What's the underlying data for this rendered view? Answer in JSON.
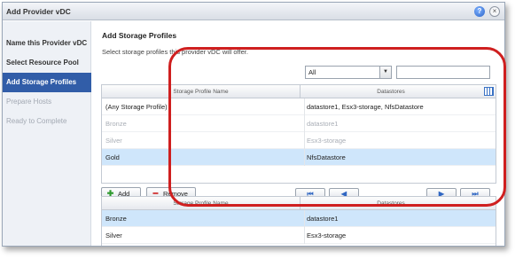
{
  "window": {
    "title": "Add Provider vDC"
  },
  "sidebar": {
    "items": [
      {
        "label": "Name this Provider vDC"
      },
      {
        "label": "Select Resource Pool"
      },
      {
        "label": "Add Storage Profiles"
      },
      {
        "label": "Prepare Hosts"
      },
      {
        "label": "Ready to Complete"
      }
    ]
  },
  "main": {
    "heading": "Add Storage Profiles",
    "subtitle": "Select storage profiles this provider vDC will offer.",
    "filter": {
      "selected": "All"
    },
    "available_table": {
      "columns": [
        "Storage Profile Name",
        "Datastores"
      ],
      "rows": [
        {
          "name": "(Any Storage Profile)",
          "datastores": "datastore1, Esx3-storage, NfsDatastore"
        },
        {
          "name": "Bronze",
          "datastores": "datastore1"
        },
        {
          "name": "Silver",
          "datastores": "Esx3-storage"
        },
        {
          "name": "Gold",
          "datastores": "NfsDatastore"
        }
      ]
    },
    "buttons": {
      "add": "Add",
      "remove": "Remove"
    },
    "selected_table": {
      "columns": [
        "Storage Profile Name",
        "Datastores"
      ],
      "rows": [
        {
          "name": "Bronze",
          "datastores": "datastore1"
        },
        {
          "name": "Silver",
          "datastores": "Esx3-storage"
        }
      ]
    }
  },
  "colors": {
    "accent": "#315da8",
    "selection": "#cfe6fb",
    "annotation": "#cf1f1f"
  }
}
